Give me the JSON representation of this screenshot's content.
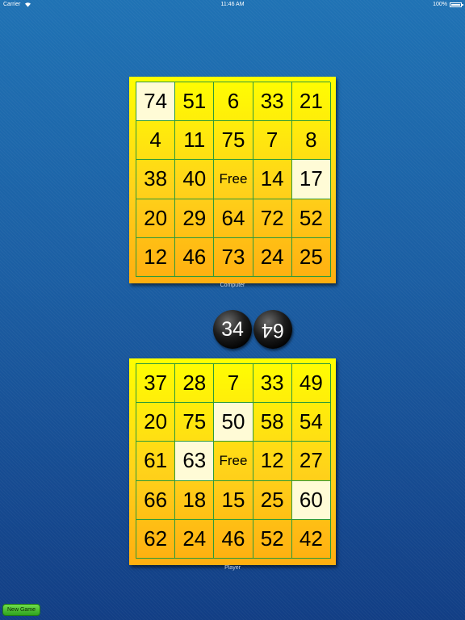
{
  "status_bar": {
    "carrier": "Carrier",
    "time": "11:46 AM",
    "battery": "100%"
  },
  "computer_card": {
    "label": "Computer",
    "rows": [
      [
        {
          "v": "74",
          "m": true
        },
        {
          "v": "51"
        },
        {
          "v": "6"
        },
        {
          "v": "33"
        },
        {
          "v": "21"
        }
      ],
      [
        {
          "v": "4"
        },
        {
          "v": "11"
        },
        {
          "v": "75"
        },
        {
          "v": "7"
        },
        {
          "v": "8"
        }
      ],
      [
        {
          "v": "38"
        },
        {
          "v": "40"
        },
        {
          "v": "Free",
          "free": true
        },
        {
          "v": "14"
        },
        {
          "v": "17",
          "m": true
        }
      ],
      [
        {
          "v": "20"
        },
        {
          "v": "29"
        },
        {
          "v": "64"
        },
        {
          "v": "72"
        },
        {
          "v": "52"
        }
      ],
      [
        {
          "v": "12"
        },
        {
          "v": "46"
        },
        {
          "v": "73"
        },
        {
          "v": "24"
        },
        {
          "v": "25"
        }
      ]
    ]
  },
  "player_card": {
    "label": "Player",
    "rows": [
      [
        {
          "v": "37"
        },
        {
          "v": "28"
        },
        {
          "v": "7"
        },
        {
          "v": "33"
        },
        {
          "v": "49"
        }
      ],
      [
        {
          "v": "20"
        },
        {
          "v": "75"
        },
        {
          "v": "50",
          "m": true
        },
        {
          "v": "58"
        },
        {
          "v": "54"
        }
      ],
      [
        {
          "v": "61"
        },
        {
          "v": "63",
          "m": true
        },
        {
          "v": "Free",
          "free": true
        },
        {
          "v": "12"
        },
        {
          "v": "27"
        }
      ],
      [
        {
          "v": "66"
        },
        {
          "v": "18"
        },
        {
          "v": "15"
        },
        {
          "v": "25"
        },
        {
          "v": "60",
          "m": true
        }
      ],
      [
        {
          "v": "62"
        },
        {
          "v": "24"
        },
        {
          "v": "46"
        },
        {
          "v": "52"
        },
        {
          "v": "42"
        }
      ]
    ]
  },
  "called_balls": [
    "34",
    "64"
  ],
  "buttons": {
    "new_game": "New Game"
  },
  "colors": {
    "card_top": "#ffff00",
    "card_bottom": "#ffae10",
    "grid_line": "#2f9a3a",
    "marked_cell": "#fffbd6"
  }
}
